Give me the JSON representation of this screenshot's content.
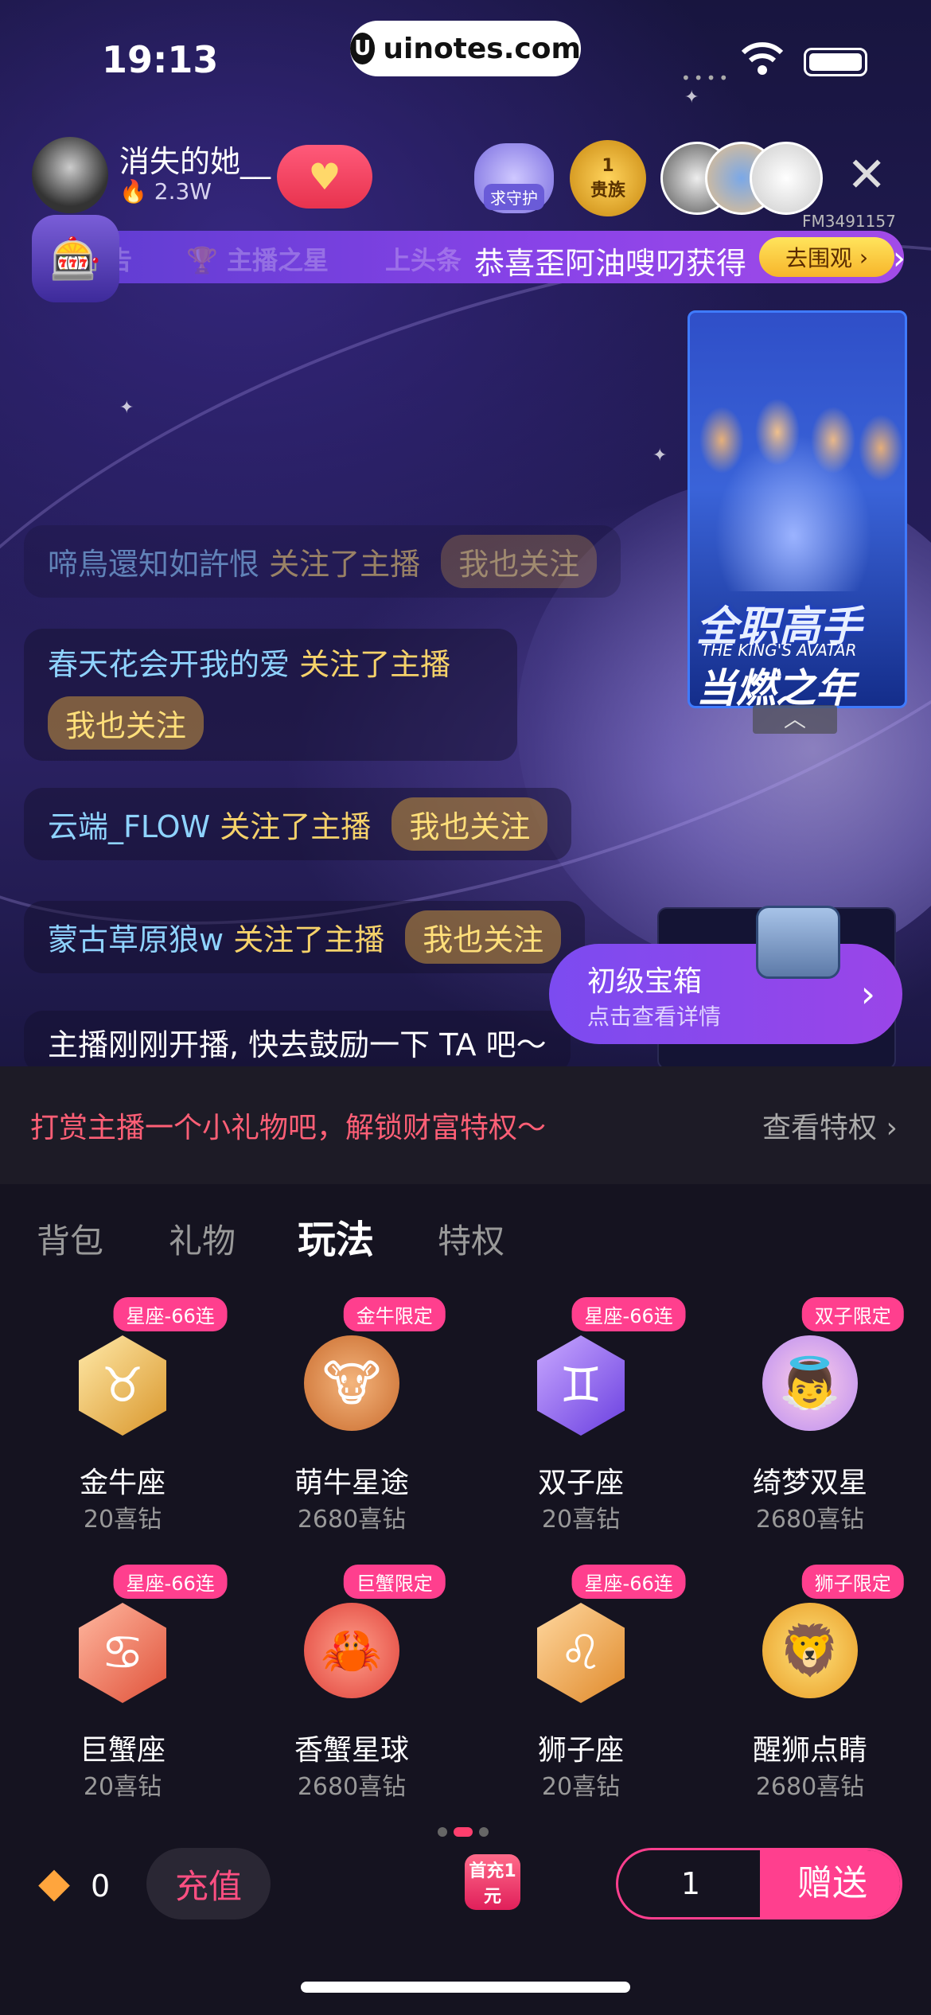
{
  "status": {
    "time": "19:13",
    "url": "uinotes.com"
  },
  "streamer": {
    "name": "消失的她__",
    "popularity": "2.3W",
    "room_id": "FM3491157"
  },
  "badges": {
    "guard": "求守护",
    "noble_level": "1",
    "noble_label": "贵族"
  },
  "banner": {
    "ghost_1": "告",
    "ghost_2": "主播之星",
    "ghost_3": "上头条",
    "message": "恭喜歪阿油嗖叼获得",
    "action": "去围观"
  },
  "poster": {
    "title": "全职高手",
    "subtitle": "THE KING'S AVATAR",
    "tagline": "当燃之年"
  },
  "chat": [
    {
      "user": "啼鳥還知如許恨",
      "action": "关注了主播",
      "button": "我也关注"
    },
    {
      "user": "春天花会开我的爱",
      "action": "关注了主播",
      "button": "我也关注"
    },
    {
      "user": "云端_FLOW",
      "action": "关注了主播",
      "button": "我也关注"
    },
    {
      "user": "蒙古草原狼w",
      "action": "关注了主播",
      "button": "我也关注"
    },
    {
      "system": "主播刚刚开播, 快去鼓励一下 TA 吧～"
    }
  ],
  "treasure": {
    "title": "初级宝箱",
    "subtitle": "点击查看详情"
  },
  "tip": {
    "text": "打赏主播一个小礼物吧，解锁财富特权～",
    "link": "查看特权"
  },
  "tabs": [
    "背包",
    "礼物",
    "玩法",
    "特权"
  ],
  "active_tab": "玩法",
  "gifts": [
    {
      "tag": "星座-66连",
      "name": "金牛座",
      "price": "20喜钻",
      "symbol": "♉"
    },
    {
      "tag": "金牛限定",
      "name": "萌牛星途",
      "price": "2680喜钻",
      "symbol": "🐮"
    },
    {
      "tag": "星座-66连",
      "name": "双子座",
      "price": "20喜钻",
      "symbol": "♊"
    },
    {
      "tag": "双子限定",
      "name": "绮梦双星",
      "price": "2680喜钻",
      "symbol": "👼"
    },
    {
      "tag": "星座-66连",
      "name": "巨蟹座",
      "price": "20喜钻",
      "symbol": "♋"
    },
    {
      "tag": "巨蟹限定",
      "name": "香蟹星球",
      "price": "2680喜钻",
      "symbol": "🦀"
    },
    {
      "tag": "星座-66连",
      "name": "狮子座",
      "price": "20喜钻",
      "symbol": "♌"
    },
    {
      "tag": "狮子限定",
      "name": "醒狮点睛",
      "price": "2680喜钻",
      "symbol": "🦁"
    }
  ],
  "footer": {
    "balance": "0",
    "recharge": "充值",
    "first_charge": "首充1元",
    "quantity": "1",
    "send": "赠送"
  }
}
